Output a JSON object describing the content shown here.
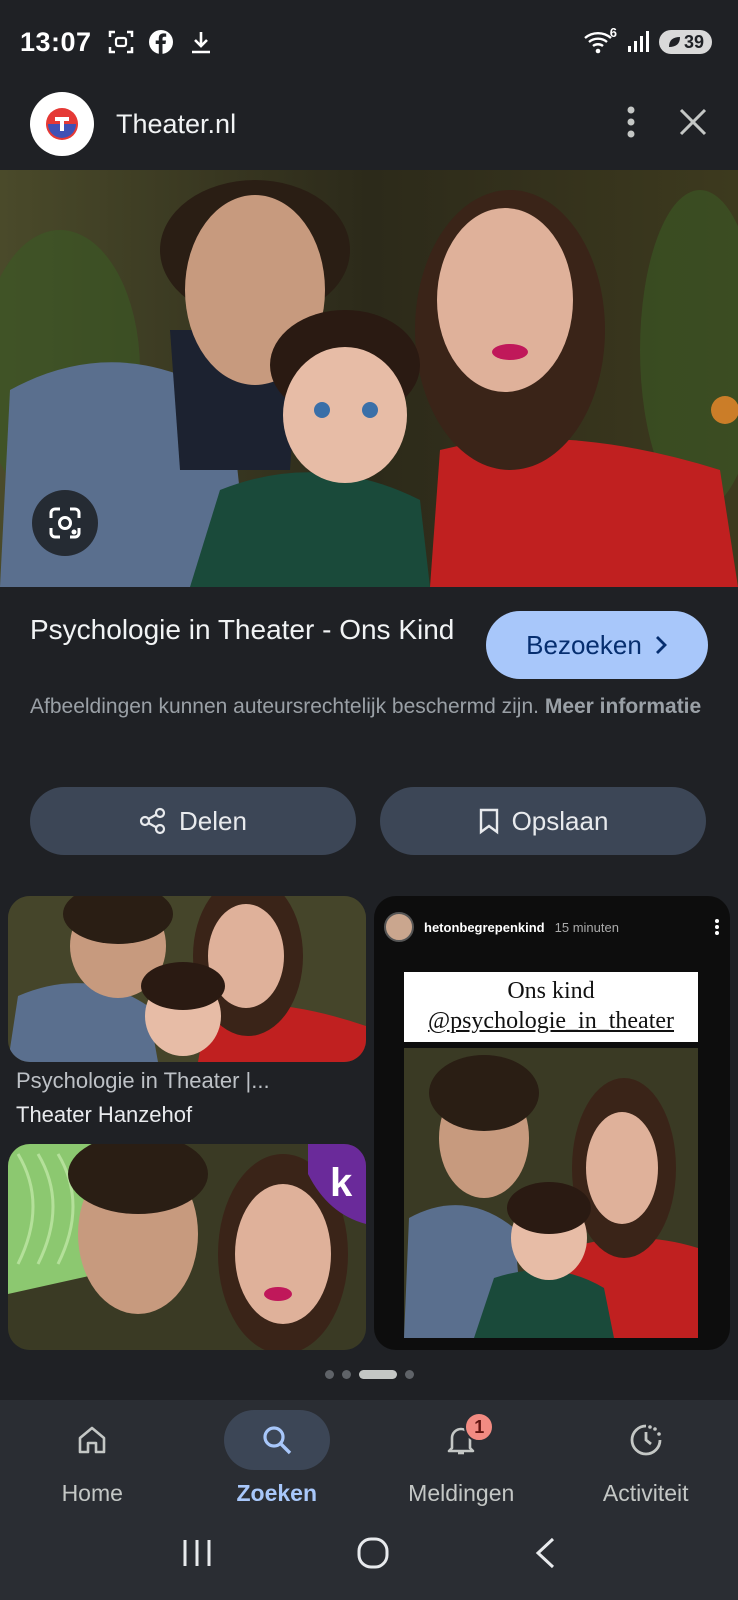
{
  "status_bar": {
    "time": "13:07",
    "left_icons": [
      "screenshot-icon",
      "facebook-icon",
      "download-icon"
    ],
    "wifi_label": "6",
    "battery": "39"
  },
  "header": {
    "site_name": "Theater.nl",
    "logo_letter": "T"
  },
  "result": {
    "title": "Psychologie in Theater - Ons Kind",
    "visit_label": "Bezoeken",
    "copyright_text": "Afbeeldingen kunnen auteursrechtelijk beschermd zijn.",
    "more_info_label": "Meer informatie",
    "share_label": "Delen",
    "save_label": "Opslaan"
  },
  "related": {
    "item1_title": "Psychologie in Theater |...",
    "item1_source": "Theater Hanzehof",
    "insta_user": "hetonbegrepenkind",
    "insta_time": "15 minuten",
    "insta_caption_line1": "Ons kind",
    "insta_caption_line2": "@psychologie_in_theater"
  },
  "pager": {
    "count": 4,
    "active": 2
  },
  "bottom_nav": {
    "items": [
      {
        "label": "Home",
        "icon": "home-icon",
        "active": false
      },
      {
        "label": "Zoeken",
        "icon": "search-icon",
        "active": true
      },
      {
        "label": "Meldingen",
        "icon": "bell-icon",
        "active": false,
        "badge": "1"
      },
      {
        "label": "Activiteit",
        "icon": "activity-icon",
        "active": false
      }
    ]
  },
  "colors": {
    "background": "#1f2125",
    "accent": "#a8c7fa",
    "button_bg": "#3c4656",
    "badge": "#f28b82"
  }
}
